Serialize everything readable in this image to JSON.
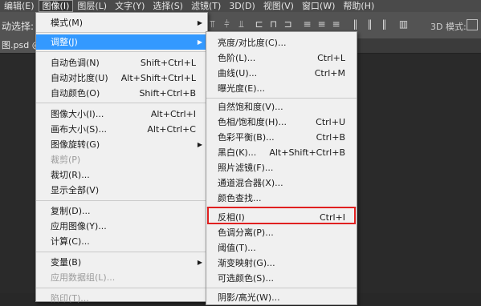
{
  "menubar": [
    {
      "label": "编辑(E)"
    },
    {
      "label": "图像(I)"
    },
    {
      "label": "图层(L)"
    },
    {
      "label": "文字(Y)"
    },
    {
      "label": "选择(S)"
    },
    {
      "label": "滤镜(T)"
    },
    {
      "label": "3D(D)"
    },
    {
      "label": "视图(V)"
    },
    {
      "label": "窗口(W)"
    },
    {
      "label": "帮助(H)"
    }
  ],
  "options": {
    "auto_select_label": "动选择:",
    "mode_label": "3D 模式:"
  },
  "document_tab": {
    "label": "图.psd @"
  },
  "image_menu": [
    {
      "label": "模式(M)",
      "shortcut": "",
      "arrow": "▶"
    },
    {
      "label": "调整(J)",
      "shortcut": "",
      "arrow": "▶"
    },
    {
      "label": "自动色调(N)",
      "shortcut": "Shift+Ctrl+L"
    },
    {
      "label": "自动对比度(U)",
      "shortcut": "Alt+Shift+Ctrl+L"
    },
    {
      "label": "自动颜色(O)",
      "shortcut": "Shift+Ctrl+B"
    },
    {
      "label": "图像大小(I)...",
      "shortcut": "Alt+Ctrl+I"
    },
    {
      "label": "画布大小(S)...",
      "shortcut": "Alt+Ctrl+C"
    },
    {
      "label": "图像旋转(G)",
      "shortcut": "",
      "arrow": "▶"
    },
    {
      "label": "裁剪(P)",
      "shortcut": ""
    },
    {
      "label": "裁切(R)...",
      "shortcut": ""
    },
    {
      "label": "显示全部(V)",
      "shortcut": ""
    },
    {
      "label": "复制(D)...",
      "shortcut": ""
    },
    {
      "label": "应用图像(Y)...",
      "shortcut": ""
    },
    {
      "label": "计算(C)...",
      "shortcut": ""
    },
    {
      "label": "变量(B)",
      "shortcut": "",
      "arrow": "▶"
    },
    {
      "label": "应用数据组(L)...",
      "shortcut": ""
    },
    {
      "label": "陷印(T)...",
      "shortcut": ""
    }
  ],
  "adjust_menu": [
    {
      "label": "亮度/对比度(C)...",
      "shortcut": ""
    },
    {
      "label": "色阶(L)...",
      "shortcut": "Ctrl+L"
    },
    {
      "label": "曲线(U)...",
      "shortcut": "Ctrl+M"
    },
    {
      "label": "曝光度(E)...",
      "shortcut": ""
    },
    {
      "label": "自然饱和度(V)...",
      "shortcut": ""
    },
    {
      "label": "色相/饱和度(H)...",
      "shortcut": "Ctrl+U"
    },
    {
      "label": "色彩平衡(B)...",
      "shortcut": "Ctrl+B"
    },
    {
      "label": "黑白(K)...",
      "shortcut": "Alt+Shift+Ctrl+B"
    },
    {
      "label": "照片滤镜(F)...",
      "shortcut": ""
    },
    {
      "label": "通道混合器(X)...",
      "shortcut": ""
    },
    {
      "label": "颜色查找...",
      "shortcut": ""
    },
    {
      "label": "反相(I)",
      "shortcut": "Ctrl+I"
    },
    {
      "label": "色调分离(P)...",
      "shortcut": ""
    },
    {
      "label": "阈值(T)...",
      "shortcut": ""
    },
    {
      "label": "渐变映射(G)...",
      "shortcut": ""
    },
    {
      "label": "可选颜色(S)...",
      "shortcut": ""
    },
    {
      "label": "阴影/高光(W)...",
      "shortcut": ""
    }
  ],
  "colors": {
    "highlight": "#3399ff",
    "callout": "#e02020"
  }
}
